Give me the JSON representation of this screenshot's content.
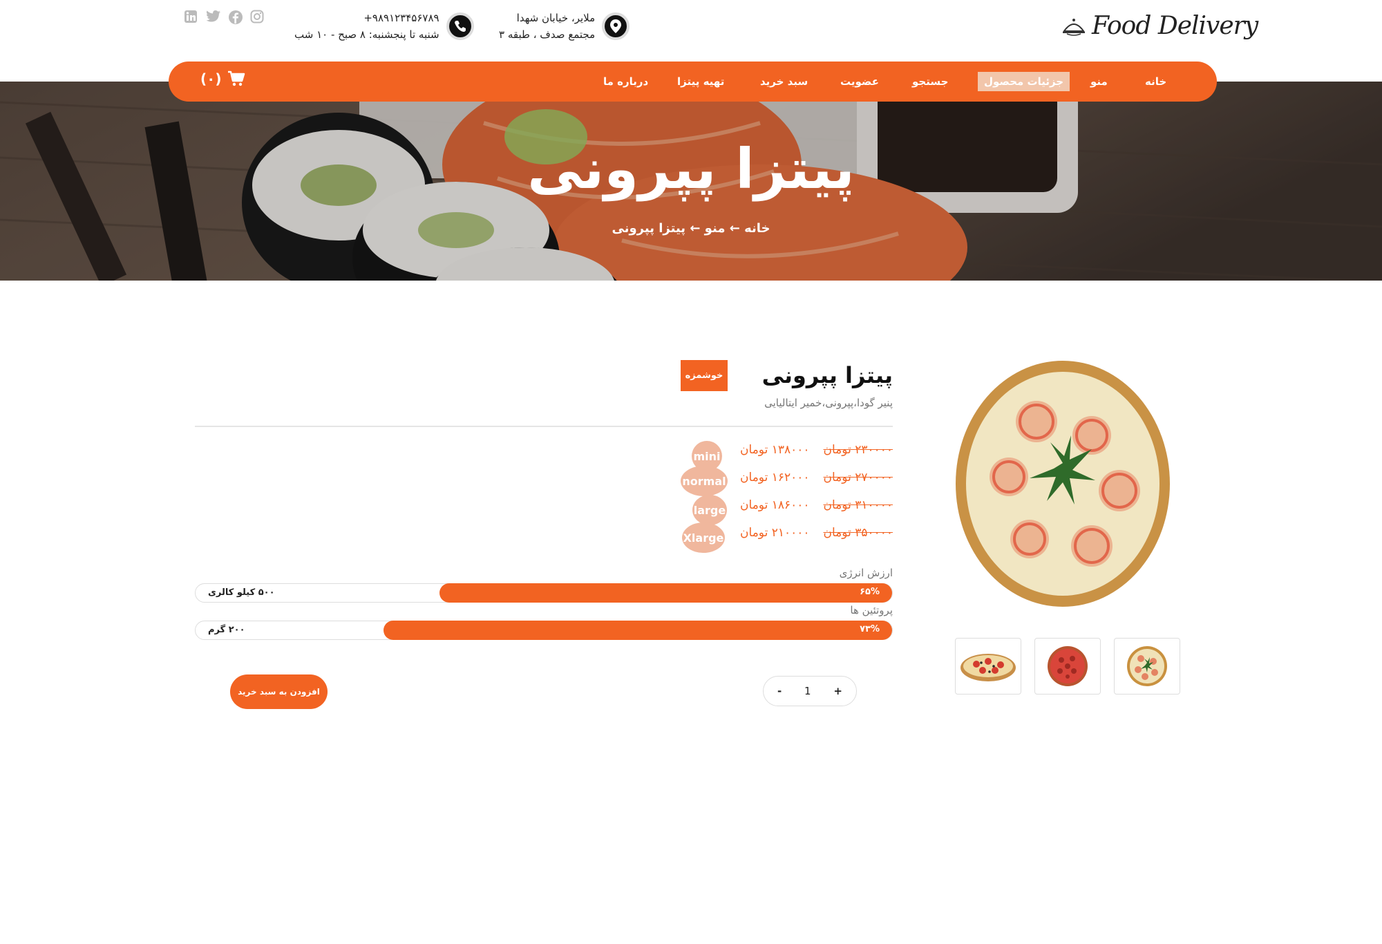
{
  "brand": {
    "name": "Food Delivery"
  },
  "contact": {
    "address_line1": "ملایر، خیابان شهدا",
    "address_line2": "مجتمع صدف ، طبقه ۳",
    "phone": "+۹۸۹۱۲۳۴۵۶۷۸۹",
    "hours": "شنبه تا پنجشنبه: ۸ صبح - ۱۰ شب"
  },
  "socials": [
    "instagram-icon",
    "facebook-icon",
    "twitter-icon",
    "linkedin-icon"
  ],
  "nav": {
    "items": [
      "خانه",
      "منو",
      "جزئیات محصول",
      "جستجو",
      "عضویت",
      "سبد خرید",
      "تهیه پیتزا",
      "درباره ما"
    ],
    "active": "جزئیات محصول",
    "cart_count": "(۰)"
  },
  "hero": {
    "title": "پیتزا پپرونی",
    "breadcrumb": "خانه ← منو ← پیتزا پپرونی"
  },
  "product": {
    "title": "پیتزا پپرونی",
    "tag": "خوشمزه",
    "ingredients": "پنیر گودا،پپرونی،خمیر ایتالیایی",
    "prices": [
      {
        "size": "mini",
        "old": "۲۳۰۰۰۰ تومان",
        "new": "۱۳۸۰۰۰ تومان"
      },
      {
        "size": "normal",
        "old": "۲۷۰۰۰۰ تومان",
        "new": "۱۶۲۰۰۰ تومان"
      },
      {
        "size": "large",
        "old": "۳۱۰۰۰۰ تومان",
        "new": "۱۸۶۰۰۰ تومان"
      },
      {
        "size": "Xlarge",
        "old": "۳۵۰۰۰۰ تومان",
        "new": "۲۱۰۰۰۰ تومان"
      }
    ],
    "nutrition": [
      {
        "label": "ارزش انرژی",
        "percent_text": "۶۵%",
        "percent": 65,
        "value": "۵۰۰ کیلو کالری"
      },
      {
        "label": "پروتئین ها",
        "percent_text": "۷۳%",
        "percent": 73,
        "value": "۲۰۰ گرم"
      }
    ],
    "quantity": "1",
    "minus": "-",
    "plus": "+",
    "add_to_cart": "افزودن به سبد خرید"
  },
  "colors": {
    "accent": "#f26322",
    "badge": "#f0b79d"
  }
}
